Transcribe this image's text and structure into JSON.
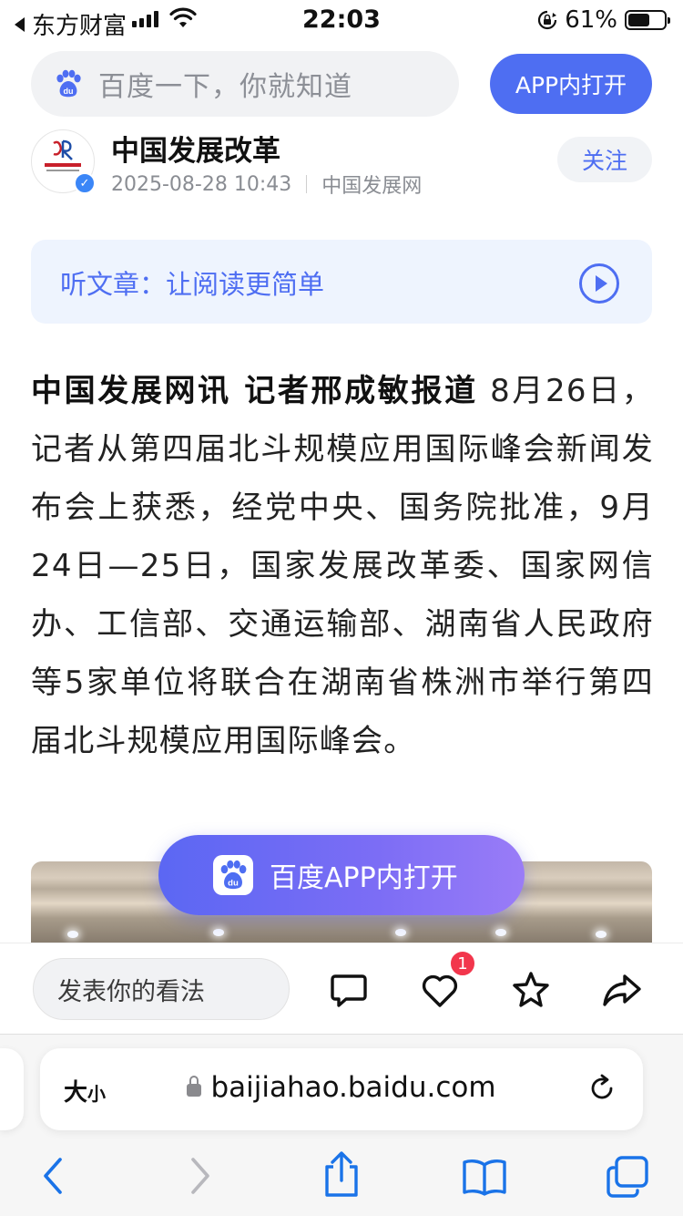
{
  "status_bar": {
    "back_app": "东方财富",
    "time": "22:03",
    "battery": "61%",
    "battery_level": 0.61
  },
  "search": {
    "placeholder": "百度一下，你就知道",
    "open_app_label": "APP内打开"
  },
  "author": {
    "name": "中国发展改革",
    "datetime": "2025-08-28 10:43",
    "source": "中国发展网",
    "follow_label": "关注"
  },
  "listen": {
    "label": "听文章：让阅读更简单"
  },
  "article": {
    "lead": "中国发展网讯 记者邢成敏报道",
    "body": " 8月26日，记者从第四届北斗规模应用国际峰会新闻发布会上获悉，经党中央、国务院批准，9月24日—25日，国家发展改革委、国家网信办、工信部、交通运输部、湖南省人民政府等5家单位将联合在湖南省株洲市举行第四届北斗规模应用国际峰会。"
  },
  "float_button": {
    "label": "百度APP内打开"
  },
  "comment_bar": {
    "placeholder": "发表你的看法",
    "like_count": "1"
  },
  "safari": {
    "text_size_label": "大",
    "text_size_small": "小",
    "url": "baijiahao.baidu.com"
  },
  "colors": {
    "accent": "#4e6ef2",
    "badge": "#f2364c",
    "ios_blue": "#1a73e8"
  }
}
